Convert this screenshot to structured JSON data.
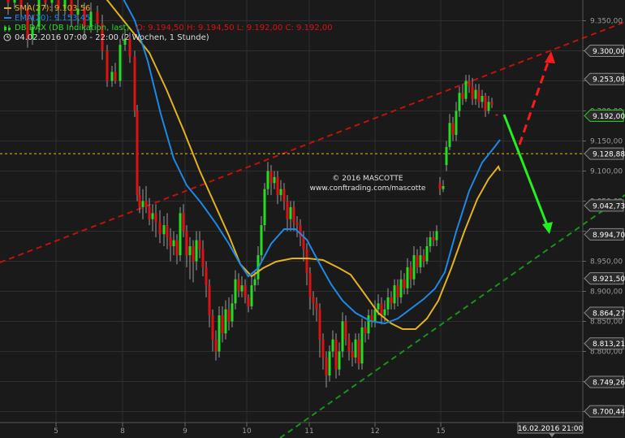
{
  "legend": {
    "sma": "SMA(27): 9.103,56",
    "ema": "EMA(20): 9.153,45",
    "instrument": "DB DAX (DB Indikation, last)",
    "ohlc": "O: 9.194,50  H: 9.194,50  L: 9.192,00  C: 9.192,00",
    "period": "04.02.2016 07:00 - 22:00 (2 Wochen, 1 Stunde)"
  },
  "watermark": {
    "line1": "© 2016 MASCOTTE",
    "line2": "www.conftrading.com/mascotte"
  },
  "crosshair_date": "16.02.2016 21:00",
  "colors": {
    "background": "#1a1a1a",
    "grid": "#2e2e2e",
    "sma": "#e3b21c",
    "ema": "#1e88e5",
    "up_candle": "#22dd22",
    "down_candle": "#dd1111",
    "wick": "#999999",
    "resistance": "#c0120a",
    "support": "#179317",
    "hline": "#e8c000",
    "arrow_up": "#ff1a1a",
    "arrow_down": "#22ee22"
  },
  "chart_data": {
    "type": "candlestick",
    "ylim": [
      8680,
      9370
    ],
    "y_ticks": [
      "9.350,00",
      "9.300,00",
      "9.250,00",
      "9.200,00",
      "9.150,00",
      "9.100,00",
      "9.050,00",
      "9.000,00",
      "8.950,00",
      "8.900,00",
      "8.850,00",
      "8.800,00",
      "8.750,00",
      "8.700,00"
    ],
    "x_ticks": [
      "5",
      "8",
      "9",
      "10",
      "11",
      "12",
      "15"
    ],
    "price_labels": [
      {
        "label": "9.300,00",
        "style": "neutral"
      },
      {
        "label": "9.253,08",
        "style": "neutral"
      },
      {
        "label": "9.192,00",
        "style": "current"
      },
      {
        "label": "9.128,88",
        "style": "neutral"
      },
      {
        "label": "9.042,73",
        "style": "neutral"
      },
      {
        "label": "8.994,70",
        "style": "neutral"
      },
      {
        "label": "8.921,50",
        "style": "neutral"
      },
      {
        "label": "8.864,27",
        "style": "neutral"
      },
      {
        "label": "8.813,21",
        "style": "neutral"
      },
      {
        "label": "8.749,26",
        "style": "neutral"
      },
      {
        "label": "8.700,44",
        "style": "neutral"
      }
    ],
    "horizontal_level": 9128.88,
    "series": [
      {
        "name": "SMA(27)",
        "kind": "sma"
      },
      {
        "name": "EMA(20)",
        "kind": "ema"
      },
      {
        "name": "DB DAX",
        "kind": "candles"
      }
    ]
  }
}
